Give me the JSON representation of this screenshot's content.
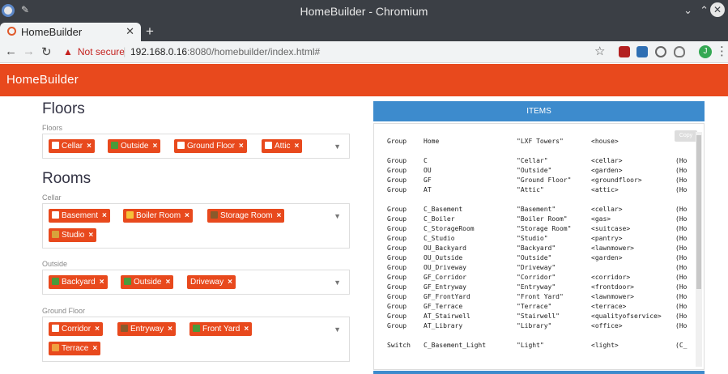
{
  "window": {
    "title": "HomeBuilder - Chromium"
  },
  "tab": {
    "label": "HomeBuilder"
  },
  "address": {
    "security": "Not secure",
    "host": "192.168.0.16",
    "path": ":8080/homebuilder/index.html#",
    "avatar_letter": "J"
  },
  "app": {
    "brand": "HomeBuilder"
  },
  "floors": {
    "title": "Floors",
    "label": "Floors",
    "chips": [
      "Cellar",
      "Outside",
      "Ground Floor",
      "Attic"
    ]
  },
  "rooms": {
    "title": "Rooms",
    "cellar": {
      "label": "Cellar",
      "chips": [
        "Basement",
        "Boiler Room",
        "Storage Room",
        "Studio"
      ]
    },
    "outside": {
      "label": "Outside",
      "chips": [
        "Backyard",
        "Outside",
        "Driveway"
      ]
    },
    "ground": {
      "label": "Ground Floor",
      "chips": [
        "Corridor",
        "Entryway",
        "Front Yard",
        "Terrace"
      ]
    }
  },
  "items": {
    "header": "ITEMS",
    "copy": "Copy",
    "rows": [
      [
        "Group",
        "Home",
        "\"LXF Towers\"",
        "<house>",
        ""
      ],
      [
        "Group",
        "C",
        "\"Cellar\"",
        "<cellar>",
        "(Ho"
      ],
      [
        "Group",
        "OU",
        "\"Outside\"",
        "<garden>",
        "(Ho"
      ],
      [
        "Group",
        "GF",
        "\"Ground Floor\"",
        "<groundfloor>",
        "(Ho"
      ],
      [
        "Group",
        "AT",
        "\"Attic\"",
        "<attic>",
        "(Ho"
      ],
      [
        "Group",
        "C_Basement",
        "\"Basement\"",
        "<cellar>",
        "(Ho"
      ],
      [
        "Group",
        "C_Boiler",
        "\"Boiler Room\"",
        "<gas>",
        "(Ho"
      ],
      [
        "Group",
        "C_StorageRoom",
        "\"Storage Room\"",
        "<suitcase>",
        "(Ho"
      ],
      [
        "Group",
        "C_Studio",
        "\"Studio\"",
        "<pantry>",
        "(Ho"
      ],
      [
        "Group",
        "OU_Backyard",
        "\"Backyard\"",
        "<lawnmower>",
        "(Ho"
      ],
      [
        "Group",
        "OU_Outside",
        "\"Outside\"",
        "<garden>",
        "(Ho"
      ],
      [
        "Group",
        "OU_Driveway",
        "\"Driveway\"",
        "",
        "(Ho"
      ],
      [
        "Group",
        "GF_Corridor",
        "\"Corridor\"",
        "<corridor>",
        "(Ho"
      ],
      [
        "Group",
        "GF_Entryway",
        "\"Entryway\"",
        "<frontdoor>",
        "(Ho"
      ],
      [
        "Group",
        "GF_FrontYard",
        "\"Front Yard\"",
        "<lawnmower>",
        "(Ho"
      ],
      [
        "Group",
        "GF_Terrace",
        "\"Terrace\"",
        "<terrace>",
        "(Ho"
      ],
      [
        "Group",
        "AT_Stairwell",
        "\"Stairwell\"",
        "<qualityofservice>",
        "(Ho"
      ],
      [
        "Group",
        "AT_Library",
        "\"Library\"",
        "<office>",
        "(Ho"
      ],
      [
        "Switch",
        "C_Basement_Light",
        "\"Light\"",
        "<light>",
        "(C_"
      ]
    ]
  }
}
